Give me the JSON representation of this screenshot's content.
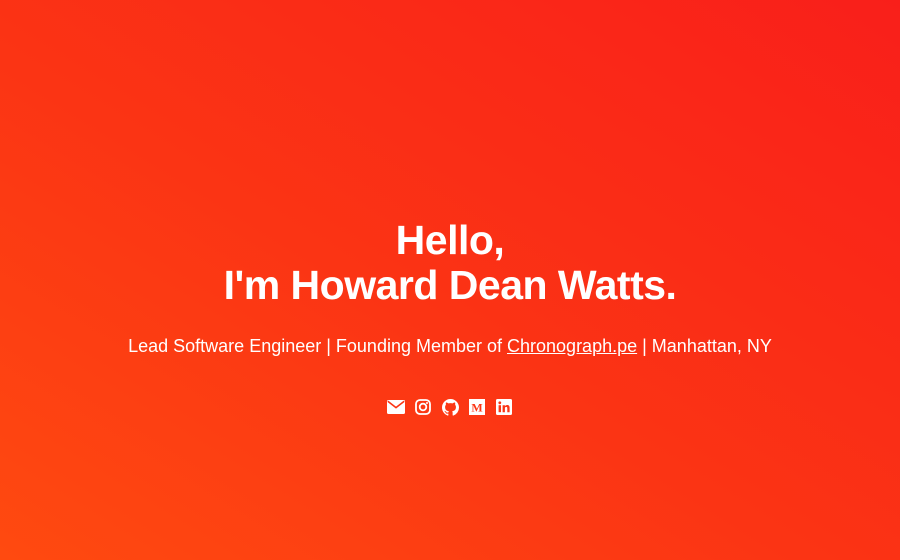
{
  "hero": {
    "greeting": "Hello,",
    "name_line": "I'm Howard Dean Watts.",
    "tagline": {
      "before": "Lead Software Engineer | Founding Member of ",
      "link_text": "Chronograph.pe",
      "after": " | Manhattan, NY"
    }
  },
  "social": [
    {
      "icon": "envelope-icon"
    },
    {
      "icon": "instagram-icon"
    },
    {
      "icon": "github-icon"
    },
    {
      "icon": "medium-icon"
    },
    {
      "icon": "linkedin-icon"
    }
  ],
  "colors": {
    "background_start": "#ff4a10",
    "background_end": "#f91f1a",
    "text": "#ffffff"
  }
}
